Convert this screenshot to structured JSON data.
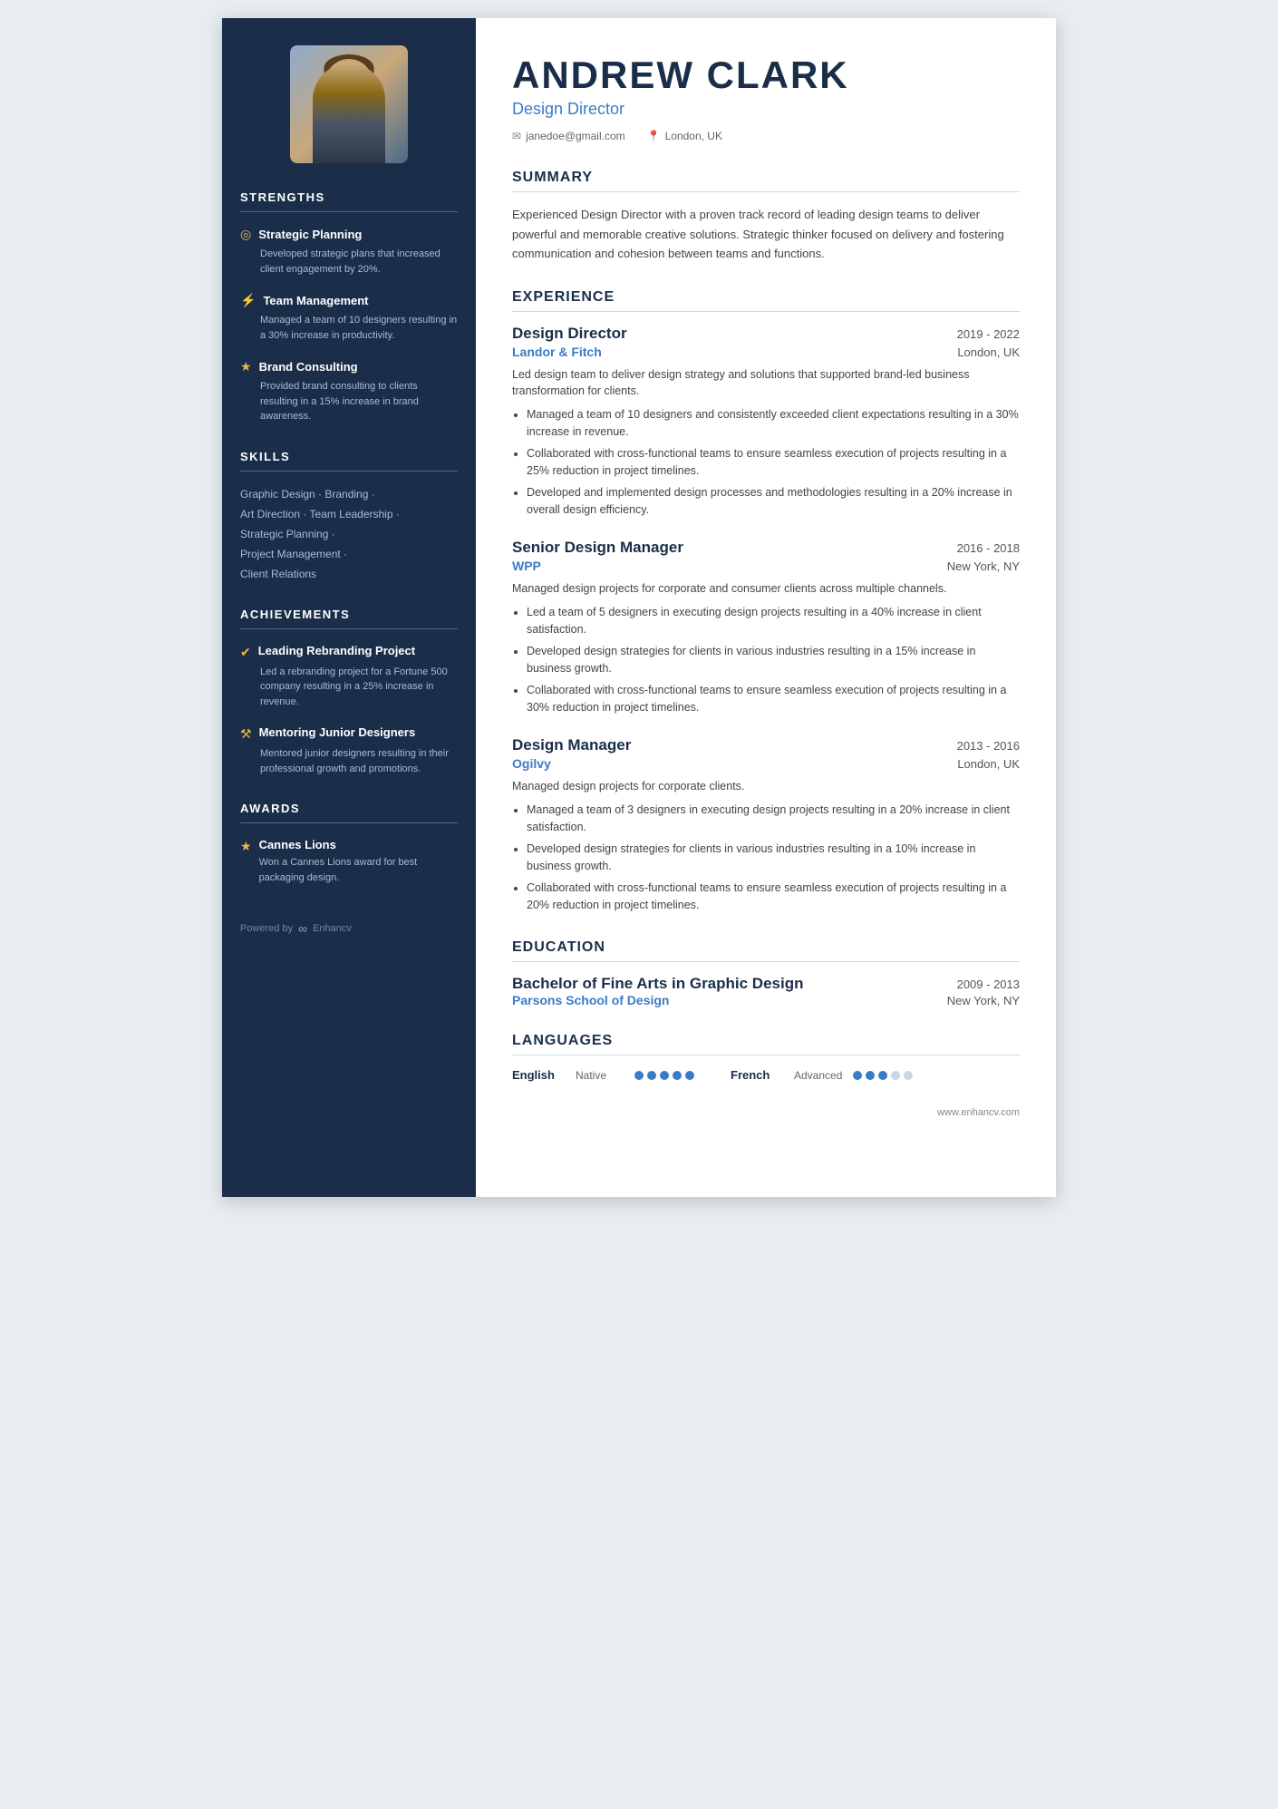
{
  "header": {
    "name": "ANDREW CLARK",
    "title": "Design Director",
    "email": "janedoe@gmail.com",
    "location": "London, UK"
  },
  "summary": {
    "section_title": "SUMMARY",
    "text": "Experienced Design Director with a proven track record of leading design teams to deliver powerful and memorable creative solutions. Strategic thinker focused on delivery and fostering communication and cohesion between teams and functions."
  },
  "experience": {
    "section_title": "EXPERIENCE",
    "entries": [
      {
        "role": "Design Director",
        "dates": "2019 - 2022",
        "company": "Landor & Fitch",
        "location": "London, UK",
        "desc": "Led design team to deliver design strategy and solutions that supported brand-led business transformation for clients.",
        "bullets": [
          "Managed a team of 10 designers and consistently exceeded client expectations resulting in a 30% increase in revenue.",
          "Collaborated with cross-functional teams to ensure seamless execution of projects resulting in a 25% reduction in project timelines.",
          "Developed and implemented design processes and methodologies resulting in a 20% increase in overall design efficiency."
        ]
      },
      {
        "role": "Senior Design Manager",
        "dates": "2016 - 2018",
        "company": "WPP",
        "location": "New York, NY",
        "desc": "Managed design projects for corporate and consumer clients across multiple channels.",
        "bullets": [
          "Led a team of 5 designers in executing design projects resulting in a 40% increase in client satisfaction.",
          "Developed design strategies for clients in various industries resulting in a 15% increase in business growth.",
          "Collaborated with cross-functional teams to ensure seamless execution of projects resulting in a 30% reduction in project timelines."
        ]
      },
      {
        "role": "Design Manager",
        "dates": "2013 - 2016",
        "company": "Ogilvy",
        "location": "London, UK",
        "desc": "Managed design projects for corporate clients.",
        "bullets": [
          "Managed a team of 3 designers in executing design projects resulting in a 20% increase in client satisfaction.",
          "Developed design strategies for clients in various industries resulting in a 10% increase in business growth.",
          "Collaborated with cross-functional teams to ensure seamless execution of projects resulting in a 20% reduction in project timelines."
        ]
      }
    ]
  },
  "education": {
    "section_title": "EDUCATION",
    "entries": [
      {
        "degree": "Bachelor of Fine Arts in Graphic Design",
        "dates": "2009 - 2013",
        "school": "Parsons School of Design",
        "location": "New York, NY"
      }
    ]
  },
  "languages": {
    "section_title": "LANGUAGES",
    "items": [
      {
        "name": "English",
        "level": "Native",
        "dots": [
          true,
          true,
          true,
          true,
          true
        ]
      },
      {
        "name": "French",
        "level": "Advanced",
        "dots": [
          true,
          true,
          true,
          false,
          false
        ]
      }
    ]
  },
  "sidebar": {
    "strengths": {
      "title": "STRENGTHS",
      "items": [
        {
          "icon": "◎",
          "title": "Strategic Planning",
          "desc": "Developed strategic plans that increased client engagement by 20%."
        },
        {
          "icon": "⚡",
          "title": "Team Management",
          "desc": "Managed a team of 10 designers resulting in a 30% increase in productivity."
        },
        {
          "icon": "★",
          "title": "Brand Consulting",
          "desc": "Provided brand consulting to clients resulting in a 15% increase in brand awareness."
        }
      ]
    },
    "skills": {
      "title": "SKILLS",
      "items": [
        "Graphic Design · Branding ·",
        "Art Direction · Team Leadership ·",
        "Strategic Planning ·",
        "Project Management ·",
        "Client Relations"
      ]
    },
    "achievements": {
      "title": "ACHIEVEMENTS",
      "items": [
        {
          "icon": "✔",
          "title": "Leading Rebranding Project",
          "desc": "Led a rebranding project for a Fortune 500 company resulting in a 25% increase in revenue."
        },
        {
          "icon": "⚒",
          "title": "Mentoring Junior Designers",
          "desc": "Mentored junior designers resulting in their professional growth and promotions."
        }
      ]
    },
    "awards": {
      "title": "AWARDS",
      "items": [
        {
          "icon": "★",
          "title": "Cannes Lions",
          "desc": "Won a Cannes Lions award for best packaging design."
        }
      ]
    },
    "footer": {
      "powered_by": "Powered by",
      "brand": "Enhancv"
    }
  },
  "main_footer": {
    "url": "www.enhancv.com"
  }
}
